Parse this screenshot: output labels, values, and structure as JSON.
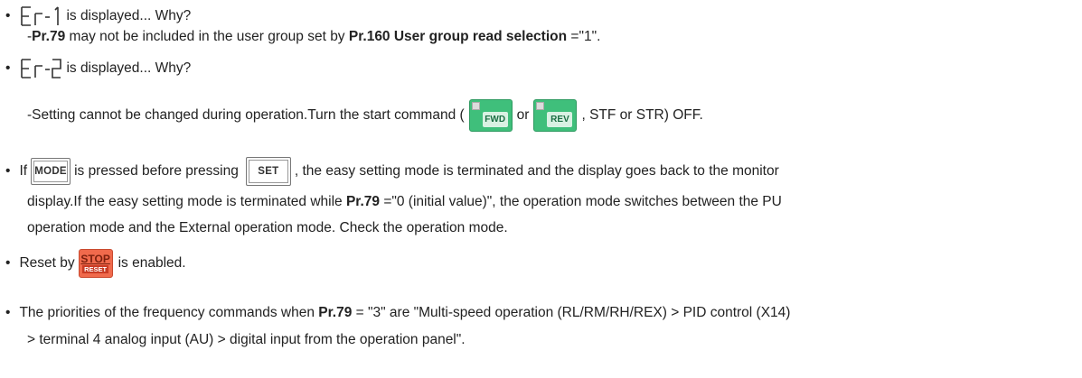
{
  "items": [
    {
      "code_label": "Er-1",
      "title_suffix": "is displayed... Why?",
      "detail_prefix": "-",
      "detail_pr79": "Pr.79",
      "detail_mid": " may not be included in the user group set by ",
      "detail_pr160": "Pr.160 User group read selection",
      "detail_end": " =\"1\"."
    },
    {
      "code_label": "Er-2",
      "title_suffix": "is displayed... Why?",
      "detail_a": "-Setting cannot be changed during operation.Turn the start command (",
      "key_fwd": "FWD",
      "detail_or": "or",
      "key_rev": "REV",
      "detail_b": ", STF or STR) OFF."
    },
    {
      "lead": "If",
      "key_mode": "MODE",
      "text_a": "is pressed before pressing",
      "key_set": "SET",
      "text_b": ", the easy setting mode is terminated and the display goes back to the monitor",
      "line2_a": "display.If the easy setting mode is terminated while ",
      "line2_pr79": "Pr.79",
      "line2_b": " =\"0 (initial value)\", the operation mode switches between the PU",
      "line3": "operation mode and the External operation mode. Check the operation mode."
    },
    {
      "text_a": "Reset by",
      "key_stop": "STOP",
      "key_reset": "RESET",
      "text_b": "is enabled."
    },
    {
      "line1_a": "The priorities of the frequency commands when ",
      "line1_pr79": "Pr.79",
      "line1_b": " = \"3\" are \"Multi-speed operation (RL/RM/RH/REX) > PID control (X14)",
      "line2": "> terminal 4 analog input (AU) > digital input from the operation panel\"."
    }
  ],
  "bullet_char": "•",
  "colors": {
    "fwd_rev_key": "#3fbf7b",
    "stop_key": "#f06a4c"
  }
}
